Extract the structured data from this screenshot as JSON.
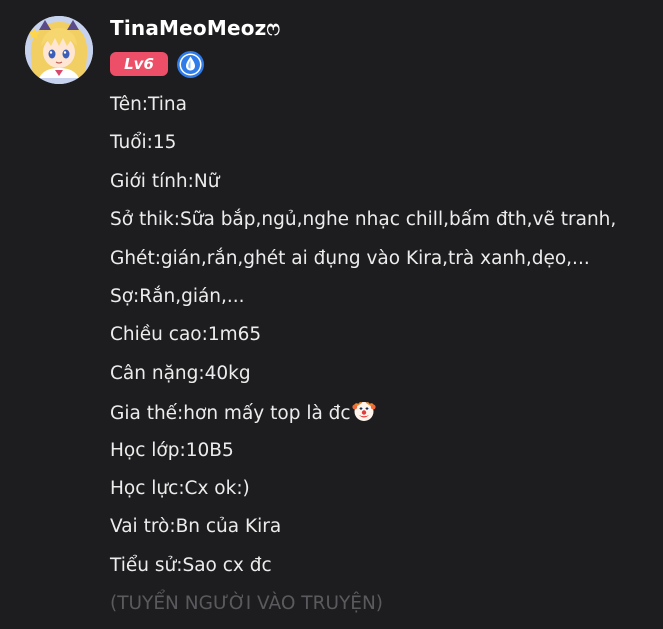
{
  "post": {
    "author": {
      "username": "TinaMeoMeozෆ",
      "level_badge": "Lv6",
      "avatar_icon": "anime-girl-avatar",
      "mod_badge_icon": "blue-droplet-badge-icon"
    },
    "bio_lines": [
      "Tên:Tina",
      "Tuổi:15",
      "Giới tính:Nữ",
      "Sở thik:Sữa bắp,ngủ,nghe nhạc chill,bấm đth,vẽ tranh,",
      "Ghét:gián,rắn,ghét ai đụng vào Kira,trà xanh,dẹo,...",
      "Sợ:Rắn,gián,...",
      "Chiều cao:1m65",
      "Cân nặng:40kg",
      "Gia thế:hơn mấy top là đc",
      "Học lớp:10B5",
      "Học lực:Cx ok:)",
      "Vai trò:Bn của Kira",
      "Tiểu sử:Sao cx đc",
      "(TUYỂN NGƯỜI VÀO TRUYỆN)"
    ],
    "emoji_after_line_9": "clown-face-emoji"
  },
  "colors": {
    "background": "#1d1d1f",
    "text": "#ececec",
    "level_badge": "#ee4f68",
    "mod_badge": "#2f7be8"
  }
}
